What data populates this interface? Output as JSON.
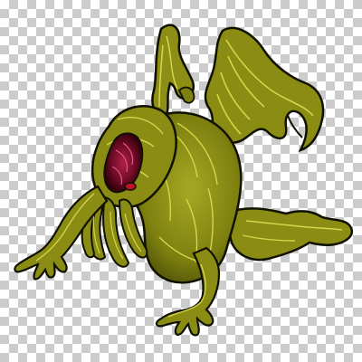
{
  "image": {
    "subject": "cthulhu-creature-illustration",
    "background": "transparency-checkerboard",
    "colors": {
      "body": "#8a8c14",
      "body_dark": "#4f5208",
      "highlight": "#d6d64a",
      "outline": "#111100",
      "wound": "#8a1030",
      "wound_dark": "#3a0010",
      "eye": "#c01028",
      "checker_light": "#ffffff",
      "checker_dark": "#cccccc"
    }
  }
}
